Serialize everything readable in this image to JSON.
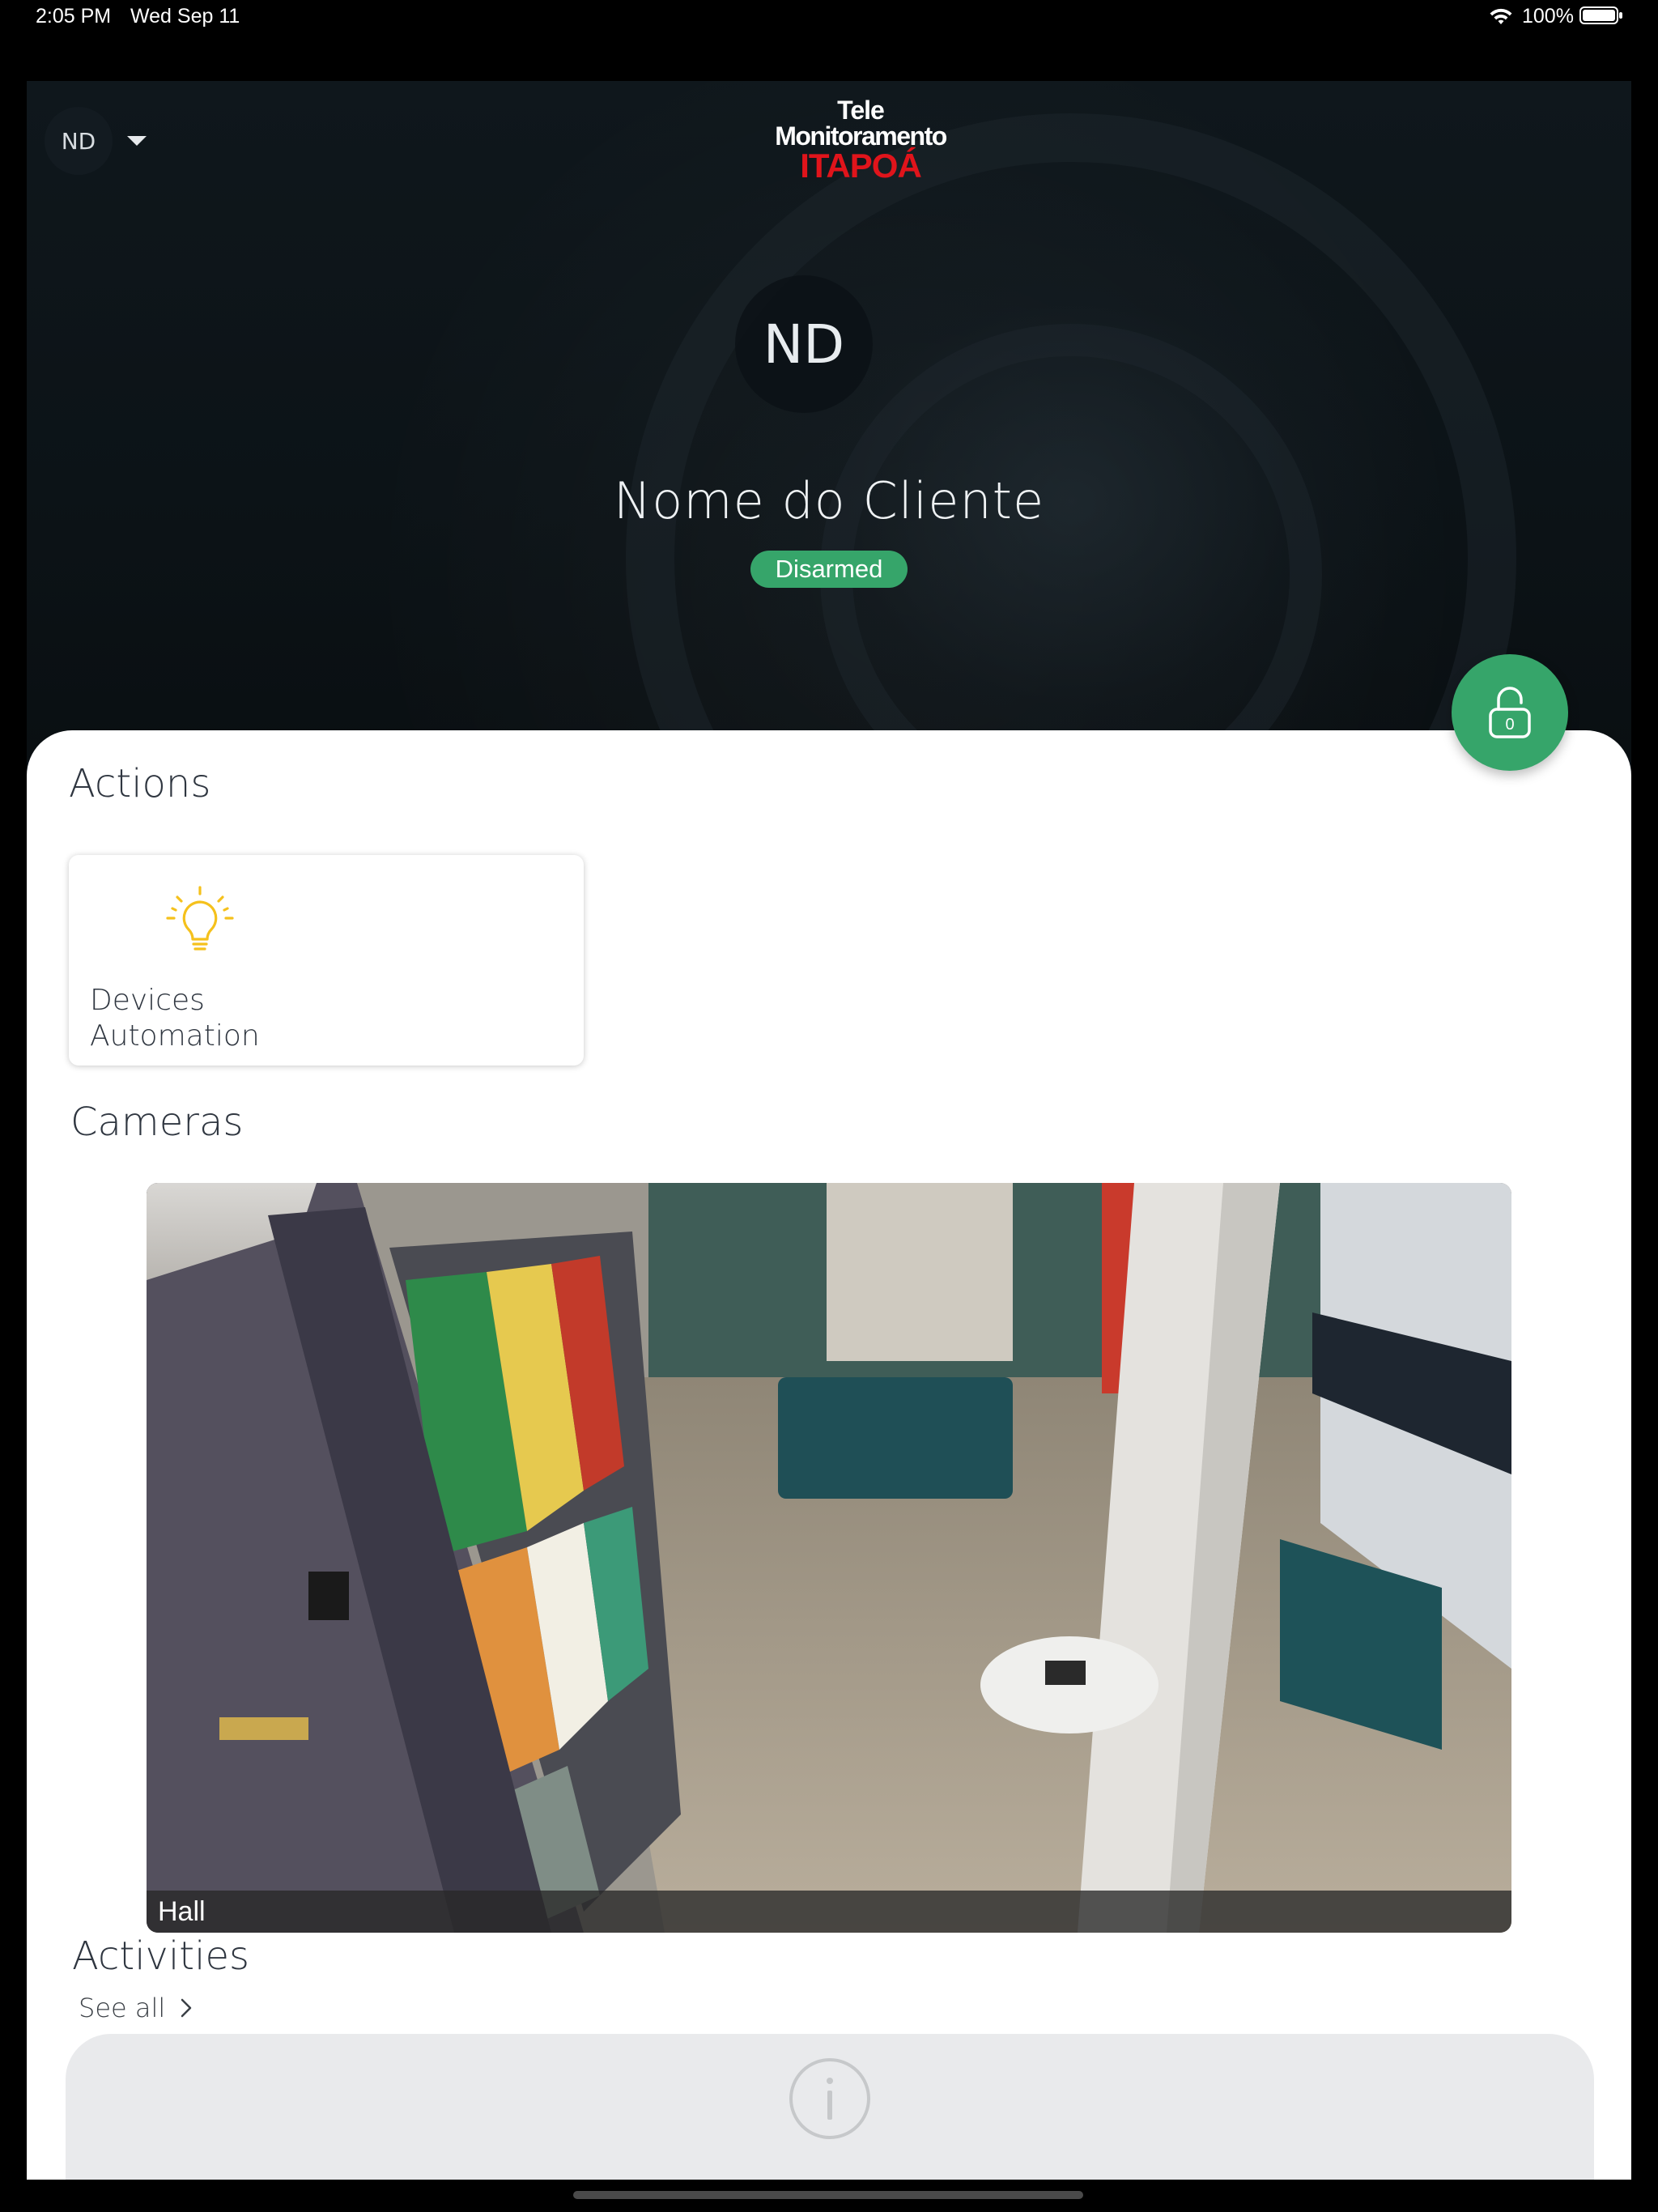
{
  "status_bar": {
    "time": "2:05 PM",
    "date": "Wed Sep 11",
    "battery": "100%"
  },
  "header": {
    "account_initials": "ND",
    "logo": {
      "line1": "Tele",
      "line2": "Monitoramento",
      "line3": "ITAPOÁ"
    },
    "client_initials": "ND",
    "client_name": "Nome do Cliente",
    "status": "Disarmed",
    "status_color": "#36a56a",
    "arm_button_icon": "unlocked-padlock-icon",
    "arm_button_count": "0"
  },
  "actions": {
    "title": "Actions",
    "items": [
      {
        "label_line1": "Devices",
        "label_line2": "Automation",
        "icon": "lightbulb-icon",
        "icon_color": "#f5c11c"
      }
    ]
  },
  "cameras": {
    "title": "Cameras",
    "items": [
      {
        "caption": "Hall"
      }
    ]
  },
  "activities": {
    "title": "Activities",
    "see_all": "See all",
    "empty_icon": "info-icon"
  }
}
